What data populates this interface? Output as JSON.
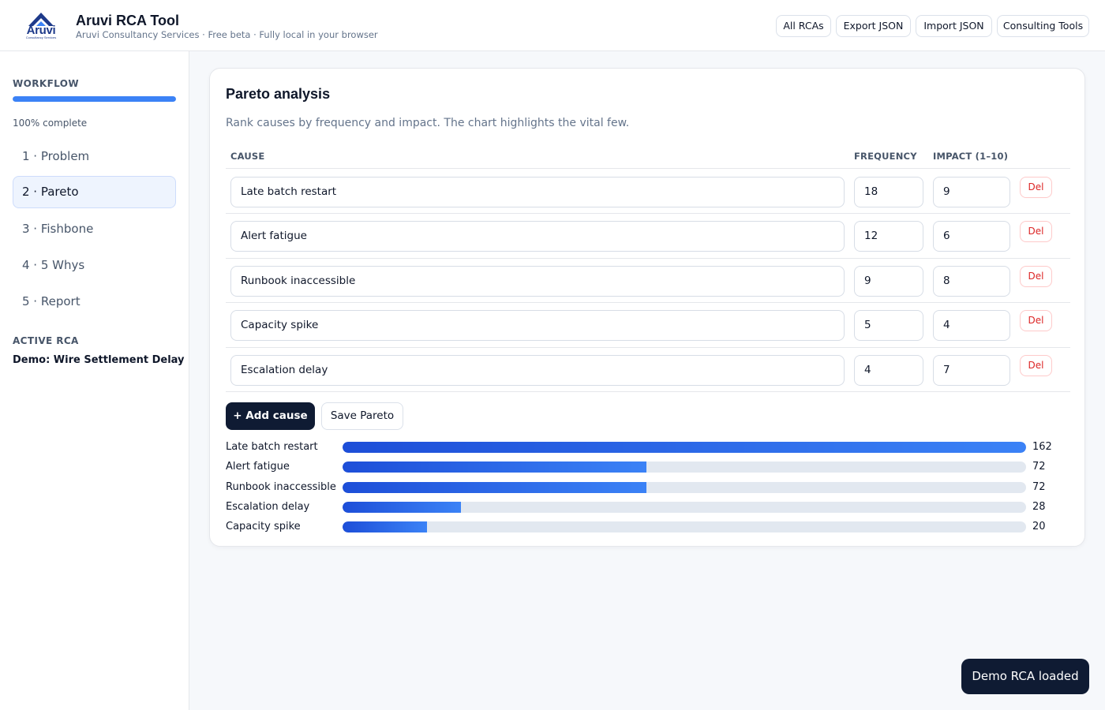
{
  "header": {
    "logo_text": "Aruvi",
    "logo_subtext": "Consultancy Services",
    "title": "Aruvi RCA Tool",
    "subtitle": "Aruvi Consultancy Services · Free beta · Fully local in your browser",
    "buttons": [
      "All RCAs",
      "Export JSON",
      "Import JSON",
      "Consulting Tools"
    ]
  },
  "sidebar": {
    "workflow_title": "WORKFLOW",
    "progress_percent": 100,
    "progress_text": "100% complete",
    "steps": [
      {
        "label": "1 · Problem",
        "active": false
      },
      {
        "label": "2 · Pareto",
        "active": true
      },
      {
        "label": "3 · Fishbone",
        "active": false
      },
      {
        "label": "4 · 5 Whys",
        "active": false
      },
      {
        "label": "5 · Report",
        "active": false
      }
    ],
    "active_rca_title": "ACTIVE RCA",
    "active_rca_name": "Demo: Wire Settlement Delay"
  },
  "main": {
    "title": "Pareto analysis",
    "description": "Rank causes by frequency and impact. The chart highlights the vital few.",
    "columns": {
      "cause": "CAUSE",
      "frequency": "FREQUENCY",
      "impact": "IMPACT (1–10)"
    },
    "rows": [
      {
        "cause": "Late batch restart",
        "frequency": "18",
        "impact": "9"
      },
      {
        "cause": "Alert fatigue",
        "frequency": "12",
        "impact": "6"
      },
      {
        "cause": "Runbook inaccessible",
        "frequency": "9",
        "impact": "8"
      },
      {
        "cause": "Capacity spike",
        "frequency": "5",
        "impact": "4"
      },
      {
        "cause": "Escalation delay",
        "frequency": "4",
        "impact": "7"
      }
    ],
    "delete_label": "Del",
    "add_label": "+  Add cause",
    "save_label": "Save Pareto"
  },
  "chart_data": {
    "type": "bar",
    "orientation": "horizontal",
    "categories": [
      "Late batch restart",
      "Alert fatigue",
      "Runbook inaccessible",
      "Escalation delay",
      "Capacity spike"
    ],
    "values": [
      162,
      72,
      72,
      28,
      20
    ],
    "xlim": [
      0,
      162
    ],
    "colors": {
      "bar": "#2563eb",
      "track": "#e2e8f0"
    }
  },
  "toast": {
    "text": "Demo RCA loaded"
  },
  "colors": {
    "accent": "#3b82f6",
    "primary_dark": "#0f1b33",
    "danger": "#dc2626"
  }
}
